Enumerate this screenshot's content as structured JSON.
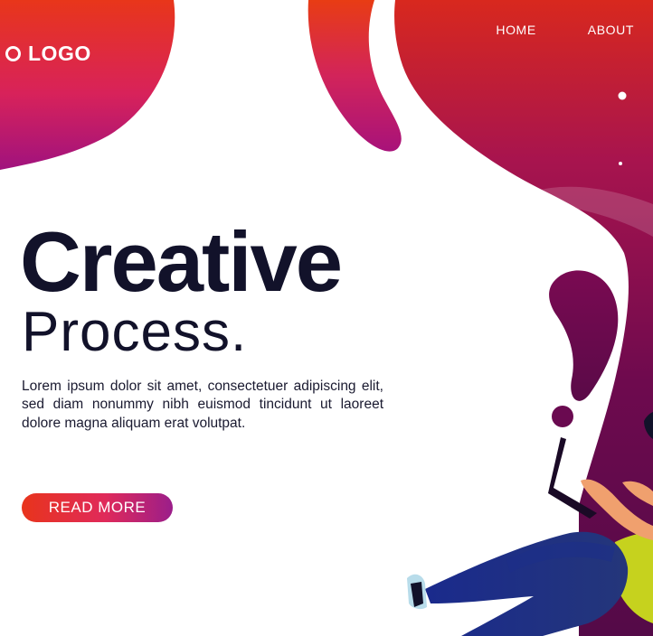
{
  "header": {
    "logo_text": "LOGO",
    "nav": [
      {
        "label": "HOME"
      },
      {
        "label": "ABOUT"
      }
    ]
  },
  "hero": {
    "title": "Creative",
    "subtitle": "Process.",
    "body": "Lorem ipsum dolor sit amet, consectetuer adipiscing elit, sed diam nonummy nibh euismod tincidunt ut laoreet dolore magna aliquam erat volutpat.",
    "cta_label": "READ MORE"
  },
  "colors": {
    "accent_red": "#e8341c",
    "accent_magenta": "#b01a78",
    "accent_plum": "#5a0a4a",
    "text_dark": "#12122a"
  },
  "illustration": {
    "icon": "person-falling-illustration"
  }
}
